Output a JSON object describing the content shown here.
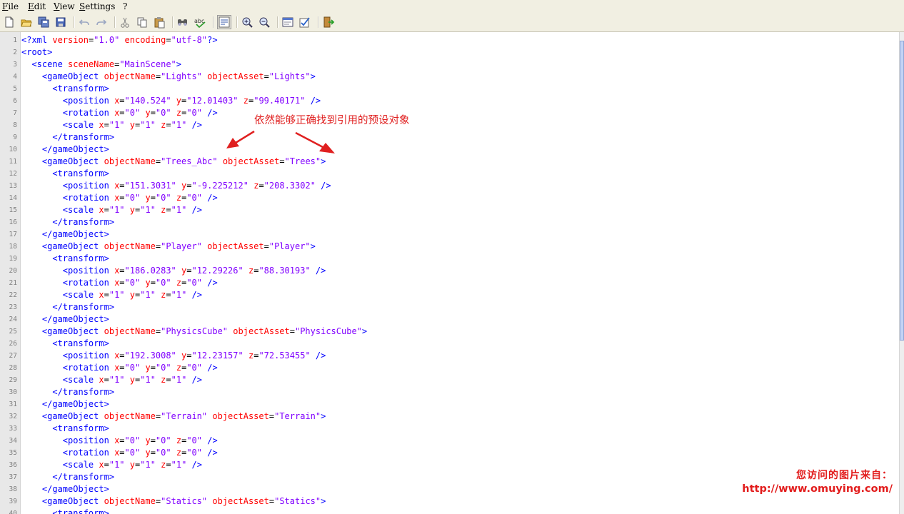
{
  "menu": [
    "File",
    "Edit",
    "View",
    "Settings",
    "?"
  ],
  "toolbar": [
    {
      "icon": "new-file-icon"
    },
    {
      "icon": "open-folder-icon"
    },
    {
      "icon": "save-all-icon"
    },
    {
      "icon": "save-icon"
    },
    {
      "sep": true
    },
    {
      "icon": "undo-icon"
    },
    {
      "icon": "redo-icon"
    },
    {
      "sep": true
    },
    {
      "icon": "cut-icon"
    },
    {
      "icon": "copy-icon"
    },
    {
      "icon": "paste-icon"
    },
    {
      "sep": true
    },
    {
      "icon": "find-icon"
    },
    {
      "icon": "spell-check-icon"
    },
    {
      "sep": true
    },
    {
      "icon": "word-wrap-icon",
      "pressed": true
    },
    {
      "sep": true
    },
    {
      "icon": "zoom-in-icon"
    },
    {
      "icon": "zoom-out-icon"
    },
    {
      "sep": true
    },
    {
      "icon": "settings-icon"
    },
    {
      "icon": "edit-check-icon"
    },
    {
      "sep": true
    },
    {
      "icon": "exit-icon"
    }
  ],
  "colors": {
    "tag": "#0000ff",
    "attr": "#ff0000",
    "value": "#8000ff",
    "annotation": "#e02020"
  },
  "code_lines": [
    "<?xml version=\"1.0\" encoding=\"utf-8\"?>",
    "<root>",
    "  <scene sceneName=\"MainScene\">",
    "    <gameObject objectName=\"Lights\" objectAsset=\"Lights\">",
    "      <transform>",
    "        <position x=\"140.524\" y=\"12.01403\" z=\"99.40171\" />",
    "        <rotation x=\"0\" y=\"0\" z=\"0\" />",
    "        <scale x=\"1\" y=\"1\" z=\"1\" />",
    "      </transform>",
    "    </gameObject>",
    "    <gameObject objectName=\"Trees_Abc\" objectAsset=\"Trees\">",
    "      <transform>",
    "        <position x=\"151.3031\" y=\"-9.225212\" z=\"208.3302\" />",
    "        <rotation x=\"0\" y=\"0\" z=\"0\" />",
    "        <scale x=\"1\" y=\"1\" z=\"1\" />",
    "      </transform>",
    "    </gameObject>",
    "    <gameObject objectName=\"Player\" objectAsset=\"Player\">",
    "      <transform>",
    "        <position x=\"186.0283\" y=\"12.29226\" z=\"88.30193\" />",
    "        <rotation x=\"0\" y=\"0\" z=\"0\" />",
    "        <scale x=\"1\" y=\"1\" z=\"1\" />",
    "      </transform>",
    "    </gameObject>",
    "    <gameObject objectName=\"PhysicsCube\" objectAsset=\"PhysicsCube\">",
    "      <transform>",
    "        <position x=\"192.3008\" y=\"12.23157\" z=\"72.53455\" />",
    "        <rotation x=\"0\" y=\"0\" z=\"0\" />",
    "        <scale x=\"1\" y=\"1\" z=\"1\" />",
    "      </transform>",
    "    </gameObject>",
    "    <gameObject objectName=\"Terrain\" objectAsset=\"Terrain\">",
    "      <transform>",
    "        <position x=\"0\" y=\"0\" z=\"0\" />",
    "        <rotation x=\"0\" y=\"0\" z=\"0\" />",
    "        <scale x=\"1\" y=\"1\" z=\"1\" />",
    "      </transform>",
    "    </gameObject>",
    "    <gameObject objectName=\"Statics\" objectAsset=\"Statics\">",
    "      <transform>"
  ],
  "line_numbers": [
    "1",
    "2",
    "3",
    "4",
    "5",
    "6",
    "7",
    "8",
    "9",
    "10",
    "11",
    "12",
    "13",
    "14",
    "15",
    "16",
    "17",
    "18",
    "19",
    "20",
    "21",
    "22",
    "23",
    "24",
    "25",
    "26",
    "27",
    "28",
    "29",
    "30",
    "31",
    "32",
    "33",
    "34",
    "35",
    "36",
    "37",
    "38",
    "39",
    "40"
  ],
  "annotation": "依然能够正确找到引用的预设对象",
  "watermark": {
    "line1": "您访问的图片来自：",
    "line2": "http://www.omuying.com/"
  }
}
